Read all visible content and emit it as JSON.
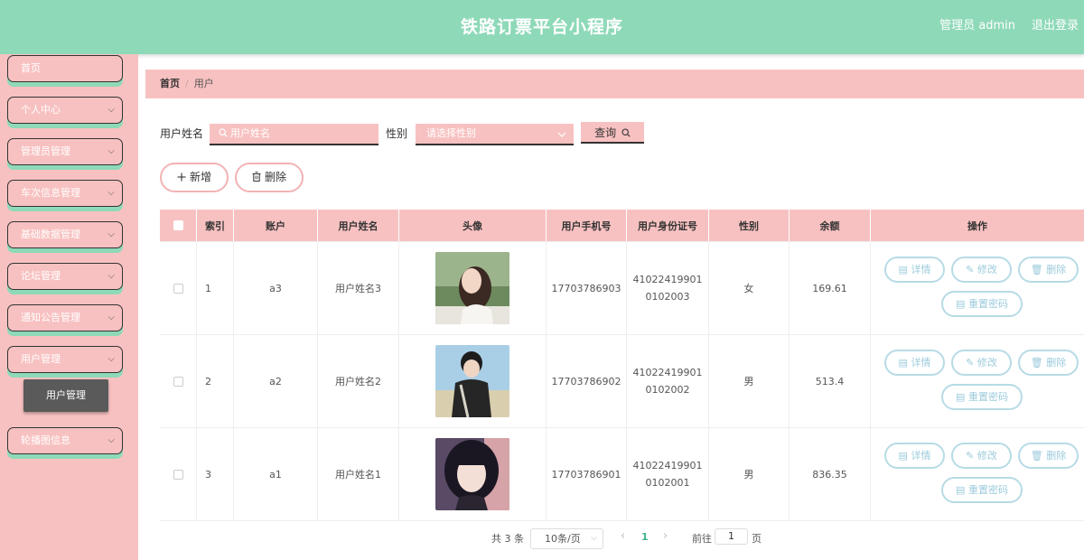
{
  "header": {
    "title": "铁路订票平台小程序",
    "admin": "管理员 admin",
    "logout": "退出登录"
  },
  "sidebar": {
    "items": [
      {
        "label": "首页"
      },
      {
        "label": "个人中心"
      },
      {
        "label": "管理员管理"
      },
      {
        "label": "车次信息管理"
      },
      {
        "label": "基础数据管理"
      },
      {
        "label": "论坛管理"
      },
      {
        "label": "通知公告管理"
      },
      {
        "label": "用户管理"
      },
      {
        "label": "轮播图信息"
      }
    ],
    "sub_item": "用户管理",
    "chevron": "⌵"
  },
  "breadcrumb": {
    "home": "首页",
    "sep": "/",
    "current": "用户"
  },
  "search": {
    "name_label": "用户姓名",
    "name_placeholder": "用户姓名",
    "gender_label": "性别",
    "gender_placeholder": "请选择性别",
    "query": "查询"
  },
  "actions": {
    "add": "新增",
    "delete": "删除"
  },
  "table": {
    "headers": [
      "索引",
      "账户",
      "用户姓名",
      "头像",
      "用户手机号",
      "用户身份证号",
      "性别",
      "余额",
      "操作"
    ],
    "rows": [
      {
        "index": "1",
        "account": "a3",
        "name": "用户姓名3",
        "phone": "17703786903",
        "id_line1": "41022419901",
        "id_line2": "0102003",
        "gender": "女",
        "balance": "169.61"
      },
      {
        "index": "2",
        "account": "a2",
        "name": "用户姓名2",
        "phone": "17703786902",
        "id_line1": "41022419901",
        "id_line2": "0102002",
        "gender": "男",
        "balance": "513.4"
      },
      {
        "index": "3",
        "account": "a1",
        "name": "用户姓名1",
        "phone": "17703786901",
        "id_line1": "41022419901",
        "id_line2": "0102001",
        "gender": "男",
        "balance": "836.35"
      }
    ],
    "ops": {
      "detail": "详情",
      "edit": "修改",
      "delete": "删除",
      "reset": "重置密码"
    }
  },
  "pagination": {
    "total": "共 3 条",
    "page_size": "10条/页",
    "current": "1",
    "goto": "前往",
    "page_input": "1",
    "page_unit": "页",
    "prev": "‹",
    "next": "›"
  },
  "colors": {
    "header": "#8ed9b8",
    "pink": "#f8c1c1",
    "active_page": "#3cb48a",
    "op_border": "#b7dbe6"
  }
}
